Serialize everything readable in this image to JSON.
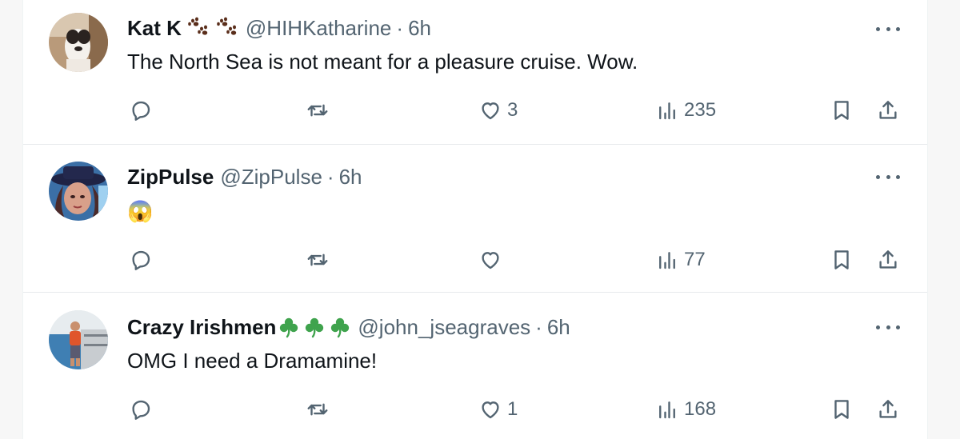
{
  "colors": {
    "text": "#0f1419",
    "secondary": "#536471",
    "divider": "#e7eaec",
    "paw": "#5a2e1b",
    "shamrock": "#3fa34d"
  },
  "posts": [
    {
      "name": "Kat K",
      "name_emoji": [
        "paw-prints-icon",
        "paw-prints-icon"
      ],
      "handle": "@HIHKatharine",
      "separator": "·",
      "time": "6h",
      "text": "The North Sea is not meant for a pleasure cruise. Wow.",
      "likes": "3",
      "views": "235"
    },
    {
      "name": "ZipPulse",
      "name_emoji": [],
      "handle": "@ZipPulse",
      "separator": "·",
      "time": "6h",
      "text": "😱",
      "likes": "",
      "views": "77"
    },
    {
      "name": "Crazy Irishmen",
      "name_emoji": [
        "shamrock-icon",
        "shamrock-icon",
        "shamrock-icon"
      ],
      "handle": "@john_jseagraves",
      "separator": "·",
      "time": "6h",
      "text": "OMG I need a Dramamine!",
      "likes": "1",
      "views": "168"
    }
  ]
}
